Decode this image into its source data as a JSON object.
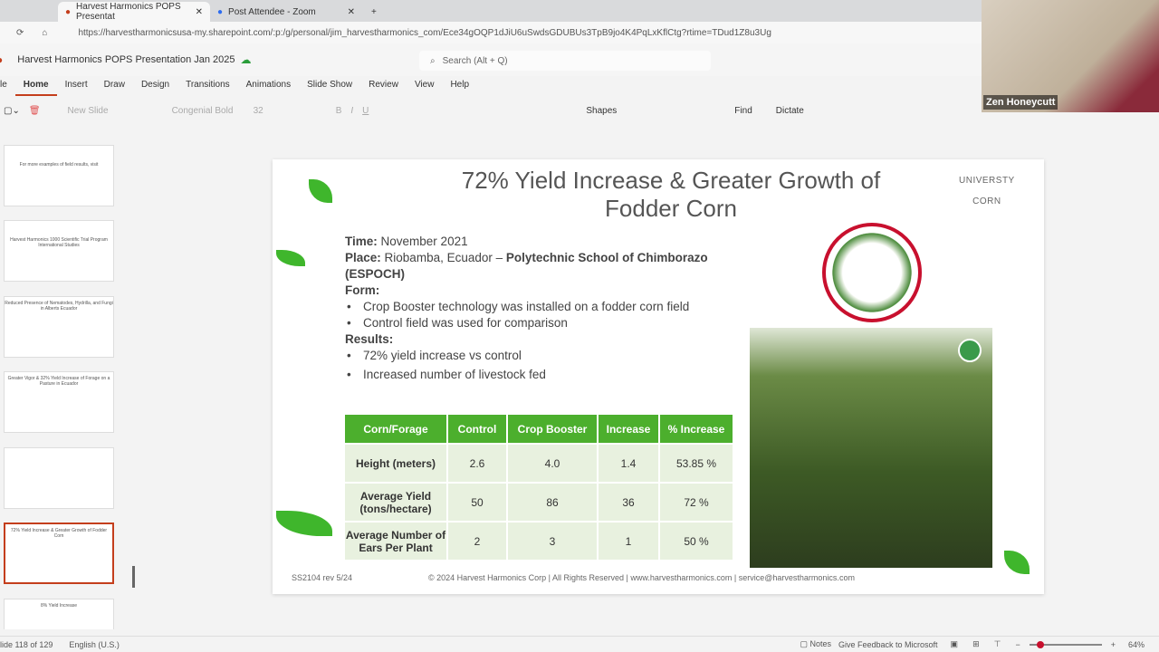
{
  "browser": {
    "tabs": [
      {
        "label": "Harvest Harmonics POPS Presentat"
      },
      {
        "label": "Post Attendee - Zoom"
      }
    ],
    "url": "https://harvestharmonicsusa-my.sharepoint.com/:p:/g/personal/jim_harvestharmonics_com/Ece34gOQP1dJiU6uSwdsGDUBUs3TpB9jo4K4PqLxKflCtg?rtime=TDud1Z8u3Ug"
  },
  "app": {
    "doc_title": "Harvest Harmonics POPS Presentation Jan 2025",
    "search_placeholder": "Search (Alt + Q)"
  },
  "menu": [
    "le",
    "Home",
    "Insert",
    "Draw",
    "Design",
    "Transitions",
    "Animations",
    "Slide Show",
    "Review",
    "View",
    "Help"
  ],
  "ribbon": {
    "new_slide": "New Slide",
    "font": "Congenial Bold",
    "size": "32",
    "shapes": "Shapes",
    "find": "Find",
    "dictate": "Dictate"
  },
  "thumbs": [
    "For more examples of field results, visit",
    "Harvest Harmonics 1000 Scientific Trial Program International Studies",
    "Reduced Presence of Nematodes, Hydrilla, and Fungi in Alberts Ecuador",
    "Greater Vigor & 32% Yield Increase of Forage on a Pasture in Ecuador",
    "",
    "72% Yield Increase & Greater Growth of Fodder Corn",
    "8% Yield Increase"
  ],
  "slide": {
    "title": "72% Yield Increase & Greater Growth of Fodder Corn",
    "tag1": "UNIVERSTY",
    "tag2": "CORN",
    "time_label": "Time:",
    "time": "November 2021",
    "place_label": "Place:",
    "place": "Riobamba, Ecuador – ",
    "place_bold": "Polytechnic School of Chimborazo (ESPOCH)",
    "form_label": "Form:",
    "form_items": [
      "Crop Booster technology was installed on a fodder corn field",
      "Control field was used for comparison"
    ],
    "results_label": "Results:",
    "results_items": [
      "72% yield increase vs control",
      "Increased number of livestock fed"
    ],
    "table": {
      "headers": [
        "Corn/Forage",
        "Control",
        "Crop Booster",
        "Increase",
        "% Increase"
      ],
      "rows": [
        [
          "Height (meters)",
          "2.6",
          "4.0",
          "1.4",
          "53.85 %"
        ],
        [
          "Average Yield (tons/hectare)",
          "50",
          "86",
          "36",
          "72 %"
        ],
        [
          "Average Number of Ears Per Plant",
          "2",
          "3",
          "1",
          "50 %"
        ]
      ]
    },
    "footer_left": "SS2104 rev 5/24",
    "footer_center": "© 2024 Harvest Harmonics Corp  |  All Rights Reserved  |  www.harvestharmonics.com  |  service@harvestharmonics.com"
  },
  "status": {
    "slide_count": "lide 118 of 129",
    "language": "English (U.S.)",
    "notes": "Notes",
    "feedback": "Give Feedback to Microsoft",
    "zoom": "64%"
  },
  "video": {
    "name": "Zen Honeycutt"
  },
  "colors": {
    "accent": "#c43e1c",
    "table_header": "#4caf2d",
    "table_cell": "#e8f1df"
  }
}
